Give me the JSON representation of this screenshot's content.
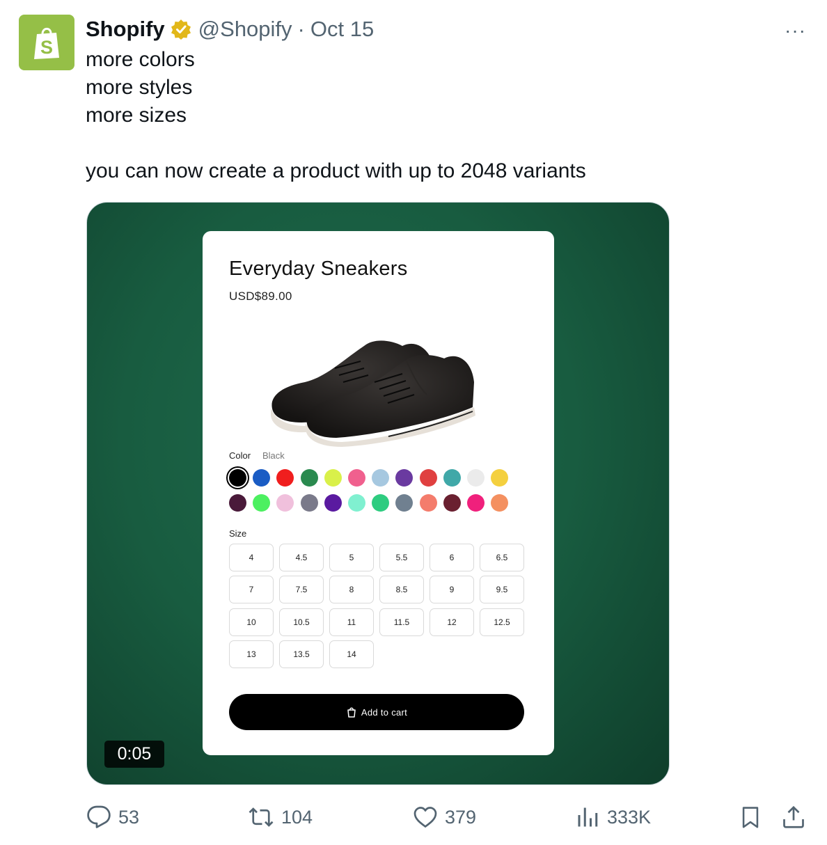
{
  "tweet": {
    "author": "Shopify",
    "handle": "@Shopify",
    "separator": "·",
    "date": "Oct 15",
    "more": "···",
    "lines": [
      "more colors",
      "more styles",
      "more sizes",
      "you can now create a product with up to 2048 variants"
    ]
  },
  "product": {
    "title": "Everyday Sneakers",
    "price": "USD$89.00",
    "color_label": "Color",
    "color_value": "Black",
    "colors": [
      "#000000",
      "#1a5cc4",
      "#f01e1e",
      "#2a8a4f",
      "#d9f04a",
      "#f0608e",
      "#a6c8e0",
      "#6a3aa0",
      "#e04040",
      "#40a8a8",
      "#ebebeb",
      "#f4d03f",
      "#4a1a3a",
      "#4cf060",
      "#f0c0dc",
      "#7a7a8a",
      "#5a1aa0",
      "#80f0d0",
      "#2ecc80",
      "#708090",
      "#f47c6c",
      "#6a2030",
      "#f0207c",
      "#f49060"
    ],
    "selected_color_index": 0,
    "size_label": "Size",
    "sizes": [
      "4",
      "4.5",
      "5",
      "5.5",
      "6",
      "6.5",
      "7",
      "7.5",
      "8",
      "8.5",
      "9",
      "9.5",
      "10",
      "10.5",
      "11",
      "11.5",
      "12",
      "12.5",
      "13",
      "13.5",
      "14"
    ],
    "cart_label": "Add to cart"
  },
  "video": {
    "duration": "0:05"
  },
  "actions": {
    "replies": "53",
    "reposts": "104",
    "likes": "379",
    "views": "333K"
  }
}
